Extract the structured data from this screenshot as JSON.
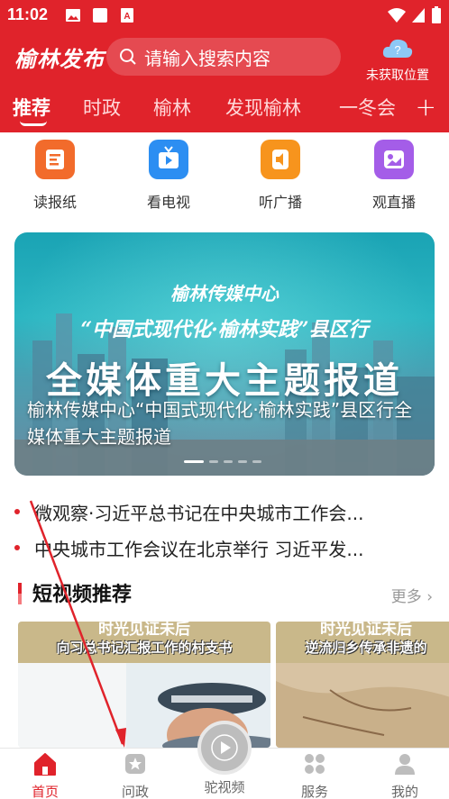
{
  "status_bar": {
    "time": "11:02"
  },
  "header": {
    "logo": "榆林发布",
    "search_placeholder": "请输入搜索内容",
    "location_text": "未获取位置"
  },
  "tabs": [
    {
      "label": "推荐",
      "active": true
    },
    {
      "label": "时政",
      "active": false
    },
    {
      "label": "榆林",
      "active": false
    },
    {
      "label": "发现榆林",
      "active": false
    },
    {
      "label": "一冬会",
      "active": false
    }
  ],
  "quick_entries": [
    {
      "label": "读报纸",
      "icon": "newspaper-icon",
      "color": "#f26b2b"
    },
    {
      "label": "看电视",
      "icon": "tv-icon",
      "color": "#2c8ef2"
    },
    {
      "label": "听广播",
      "icon": "radio-icon",
      "color": "#f7941d"
    },
    {
      "label": "观直播",
      "icon": "live-icon",
      "color": "#a45de8"
    }
  ],
  "banner": {
    "org": "榆林传媒中心",
    "subtitle": "“中国式现代化·榆林实践”县区行",
    "headline": "全媒体重大主题报道",
    "caption": "榆林传媒中心“中国式现代化·榆林实践”县区行全媒体重大主题报道"
  },
  "headlines": [
    "微观察·习近平总书记在中央城市工作会...",
    "中央城市工作会议在北京举行 习近平发..."
  ],
  "section": {
    "title": "短视频推荐",
    "more": "更多"
  },
  "videos": [
    {
      "top_text": "时光见证未后",
      "sub_text": "向习总书记汇报工作的村支书"
    },
    {
      "top_text": "时光见证未后",
      "sub_text": "逆流归乡传承非遗的"
    }
  ],
  "bottom_nav": [
    {
      "label": "首页",
      "icon": "home-icon",
      "active": true
    },
    {
      "label": "问政",
      "icon": "star-badge-icon",
      "active": false
    },
    {
      "label": "驼视频",
      "icon": "video-play-icon",
      "active": false
    },
    {
      "label": "服务",
      "icon": "grid-icon",
      "active": false
    },
    {
      "label": "我的",
      "icon": "user-icon",
      "active": false
    }
  ],
  "colors": {
    "brand_red": "#e0232b",
    "inactive_gray": "#666666"
  }
}
